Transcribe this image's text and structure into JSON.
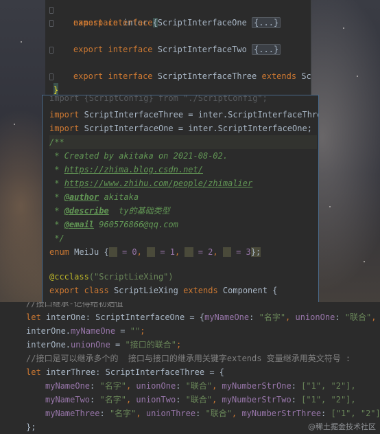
{
  "panel1": {
    "ns_kw": "namespace",
    "ns_name": "inter",
    "brace_open": "{",
    "l1_kw1": "export",
    "l1_kw2": "interface",
    "l1_name": "ScriptInterfaceOne",
    "l1_fold": "{...}",
    "l2_kw1": "export",
    "l2_kw2": "interface",
    "l2_name": "ScriptInterfaceTwo",
    "l2_fold": "{...}",
    "l3_kw1": "export",
    "l3_kw2": "interface",
    "l3_name": "ScriptInterfaceThree",
    "l3_ext": "extends",
    "l3_trunc": "Sc",
    "brace_close": "}"
  },
  "panel2": {
    "overlap": "import {ScriptConfig} from \"./ScriptConfig\";",
    "imp1_kw": "import",
    "imp1_rest": "ScriptInterfaceThree = inter.ScriptInterfaceThre",
    "imp2_kw": "import",
    "imp2_rest": "ScriptInterfaceOne = inter.ScriptInterfaceOne;",
    "doc_open": "/**",
    "doc1": " * Created by akitaka on 2021-08-02.",
    "doc2_star": " * ",
    "doc2_link": "https://zhima.blog.csdn.net/",
    "doc3_star": " * ",
    "doc3_link": "https://www.zhihu.com/people/zhimalier",
    "doc4_star": " * ",
    "doc4_tag": "@author",
    "doc4_val": " akitaka",
    "doc5_star": " * ",
    "doc5_tag": "@describe",
    "doc5_val": "  ty的基础类型",
    "doc6_star": " * ",
    "doc6_tag": "@email",
    "doc6_val": " 960576866@qq.com",
    "doc_close": " */",
    "enum_kw": "enum",
    "enum_name": "MeiJu",
    "enum_open": "{",
    "enum_v0": " = 0",
    "enum_v1": " = 1",
    "enum_v2": " = 2",
    "enum_v3": " = 3",
    "enum_close": "};",
    "deco_name": "@ccclass",
    "deco_arg": "(\"ScriptLieXing\")",
    "cls_kw1": "export",
    "cls_kw2": "class",
    "cls_name": "ScriptLieXing",
    "cls_ext": "extends",
    "cls_base": "Component {"
  },
  "panel3": {
    "cut_comment": "//接口继承-记得给初始值",
    "l1_kw": "let",
    "l1_a": "interOne: ScriptInterfaceOne = {",
    "l1_f1": "myNameOne",
    "l1_c": ": ",
    "l1_s1": "\"名字\"",
    "l1_sep": ", ",
    "l1_f2": "unionOne",
    "l1_c2": ": ",
    "l1_s2": "\"联合\"",
    "l1_trunc": ", m",
    "l2_a": "interOne.",
    "l2_f": "myNameOne",
    "l2_b": " = ",
    "l2_s": "\"\"",
    "l2_e": ";",
    "l3_a": "interOne.",
    "l3_f": "unionOne",
    "l3_b": " = ",
    "l3_s": "\"接口的联合\"",
    "l3_e": ";",
    "l4_cmt": "//接口是可以继承多个的  接口与接口的继承用关键字extends 变量继承用英文符号 :",
    "l5_kw": "let",
    "l5_a": "interThree: ScriptInterfaceThree = {",
    "r1_f1": "myNameOne",
    "r1_s1": "\"名字\"",
    "r1_f2": "unionOne",
    "r1_s2": "\"联合\"",
    "r1_f3": "myNumberStrOne",
    "r1_arr": "[\"1\", \"2\"],",
    "r2_f1": "myNameTwo",
    "r2_s1": "\"名字\"",
    "r2_f2": "unionTwo",
    "r2_s2": "\"联合\"",
    "r2_f3": "myNumberStrTwo",
    "r2_arr": "[\"1\", \"2\"],",
    "r3_f1": "myNameThree",
    "r3_s1": "\"名字\"",
    "r3_f2": "unionThree",
    "r3_s2": "\"联合\"",
    "r3_f3": "myNumberStrThree",
    "r3_arr": "[\"1\", \"2\"]",
    "l9": "};"
  },
  "watermark": "@稀土掘金技术社区"
}
